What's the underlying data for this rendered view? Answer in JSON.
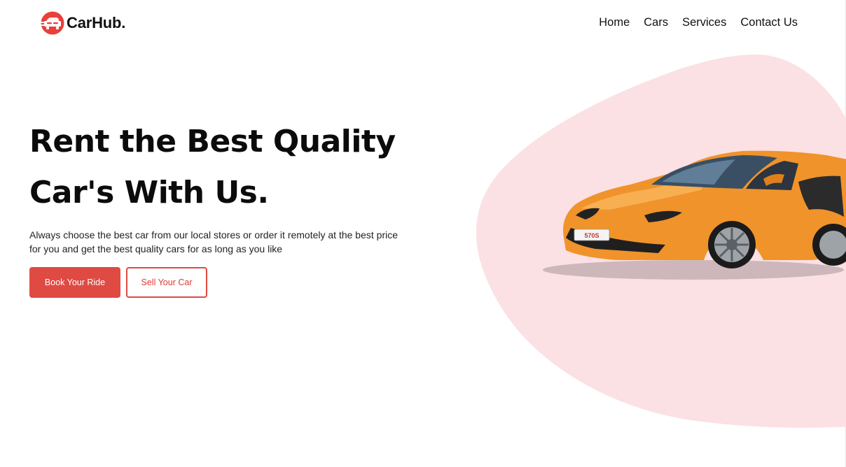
{
  "brand": {
    "name": "CarHub.",
    "accent": "#df4a43"
  },
  "nav": {
    "items": [
      {
        "label": "Home"
      },
      {
        "label": "Cars"
      },
      {
        "label": "Services"
      },
      {
        "label": "Contact Us"
      }
    ]
  },
  "hero": {
    "title_line1": "Rent the Best Quality",
    "title_line2": "Car's With Us.",
    "subtitle_line1": "Always choose the best car from our local stores or order it remotely at the best price",
    "subtitle_line2": "for you and get the best quality cars for as long as you like",
    "primary_button": "Book Your Ride",
    "secondary_button": "Sell Your Car",
    "car_plate": "570S"
  },
  "colors": {
    "blob": "#fbe0e4",
    "car_body": "#f0932b",
    "text": "#111111"
  },
  "icons": {
    "logo": "car-logo-icon"
  }
}
